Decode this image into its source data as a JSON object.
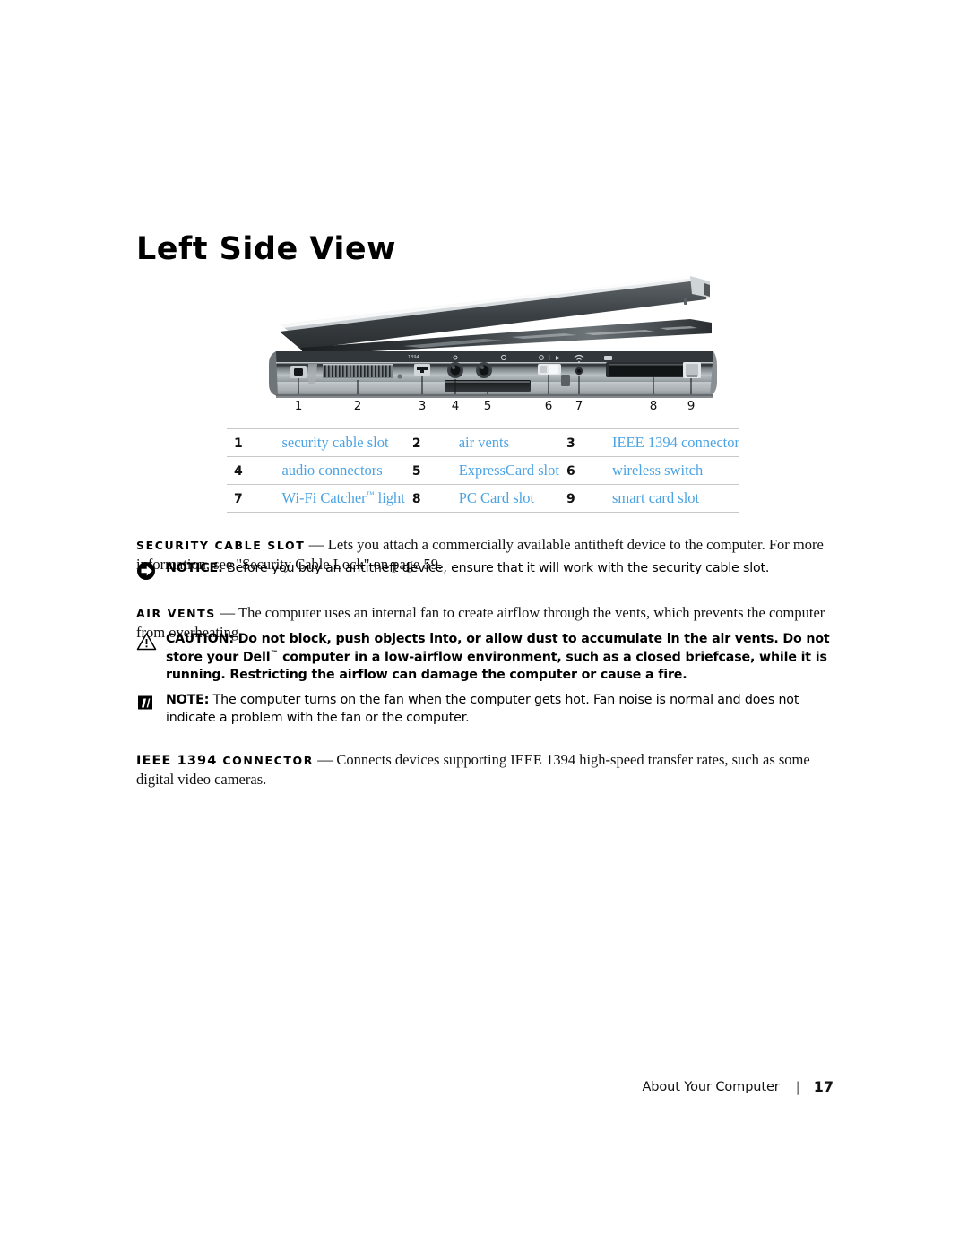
{
  "document": {
    "heading": "Left Side View",
    "footer": {
      "chapter": "About Your Computer",
      "separator": "|",
      "page_number": "17"
    }
  },
  "figure": {
    "name": "laptop-left-side-view",
    "alt": "Left side view of a Dell laptop with nine numbered callouts",
    "callout_numbers": [
      "1",
      "2",
      "3",
      "4",
      "5",
      "6",
      "7",
      "8",
      "9"
    ]
  },
  "callout_table": {
    "rows": [
      [
        {
          "num": "1",
          "label": "security cable slot"
        },
        {
          "num": "2",
          "label": "air vents"
        },
        {
          "num": "3",
          "label": "IEEE 1394 connector"
        }
      ],
      [
        {
          "num": "4",
          "label": "audio connectors"
        },
        {
          "num": "5",
          "label": "ExpressCard slot"
        },
        {
          "num": "6",
          "label": "wireless switch"
        }
      ],
      [
        {
          "num": "7",
          "label_pre": "Wi-Fi Catcher",
          "label_tm": "™",
          "label_post": " light"
        },
        {
          "num": "8",
          "label": "PC Card slot"
        },
        {
          "num": "9",
          "label": "smart card slot"
        }
      ]
    ]
  },
  "sections": {
    "security_cable_slot": {
      "term": "SECURITY CABLE SLOT",
      "dash": "—",
      "text": "Lets you attach a commercially available antitheft device to the computer. For more information, see \"Security Cable Lock\" on page 59."
    },
    "notice": {
      "icon": "notice-arrow-icon",
      "lead": "NOTICE:",
      "text": "Before you buy an antitheft device, ensure that it will work with the security cable slot."
    },
    "air_vents": {
      "term": "AIR VENTS",
      "dash": "—",
      "text": "The computer uses an internal fan to create airflow through the vents, which prevents the computer from overheating."
    },
    "caution": {
      "icon": "warning-triangle-icon",
      "lead": "CAUTION:",
      "text_pre": "Do not block, push objects into, or allow dust to accumulate in the air vents. Do not store your Dell",
      "tm": "™",
      "text_post": " computer in a low-airflow environment, such as a closed briefcase, while it is running. Restricting the airflow can damage the computer or cause a fire."
    },
    "note": {
      "icon": "note-pencil-icon",
      "lead": "NOTE:",
      "text": "The computer turns on the fan when the computer gets hot. Fan noise is normal and does not indicate a problem with the fan or the computer."
    },
    "ieee_1394_connector": {
      "term_large": "IEEE 1394",
      "term_small": "CONNECTOR",
      "dash": "—",
      "text": "Connects devices supporting IEEE 1394 high-speed transfer rates, such as some digital video cameras."
    }
  },
  "colors": {
    "link_blue": "#4ba3e3",
    "rule_gray": "#c8c8c8",
    "text_black": "#111111"
  }
}
